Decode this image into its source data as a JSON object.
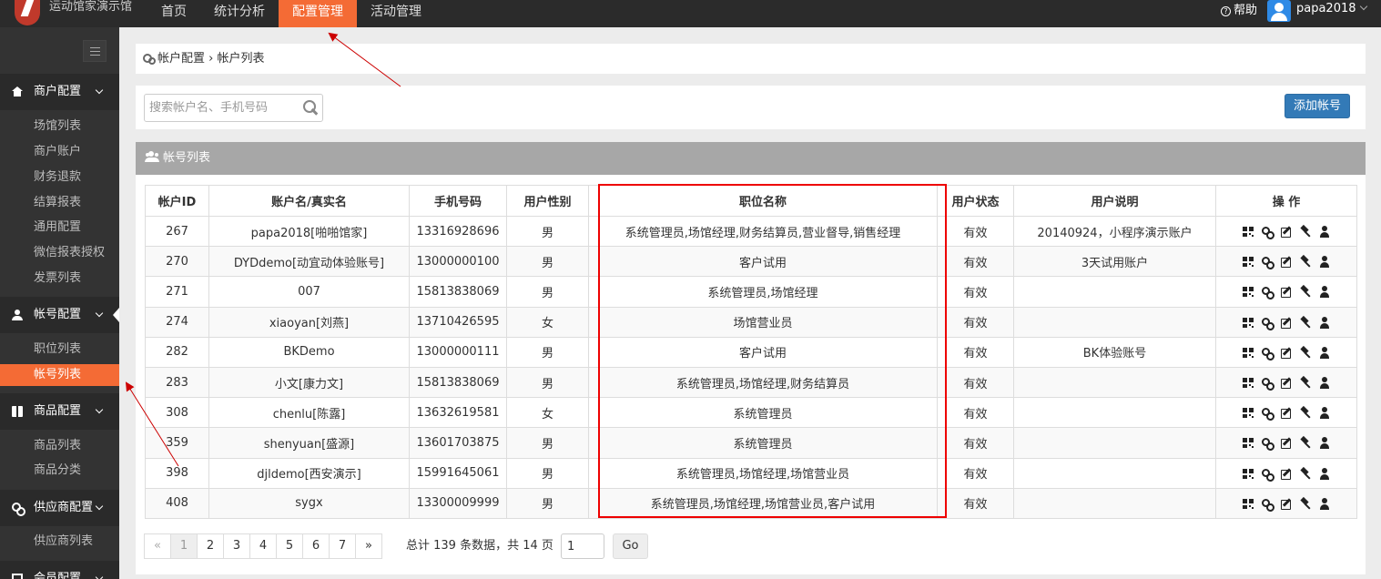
{
  "topbar": {
    "brand": "运动馆家演示馆",
    "nav": [
      {
        "label": "首页"
      },
      {
        "label": "统计分析"
      },
      {
        "label": "配置管理",
        "active": true
      },
      {
        "label": "活动管理"
      }
    ],
    "help": "帮助",
    "username": "papa2018"
  },
  "sidebar": {
    "groups": [
      {
        "label": "商户配置",
        "icon": "home-icon",
        "items": [
          "场馆列表",
          "商户账户",
          "财务退款",
          "结算报表",
          "通用配置",
          "微信报表授权",
          "发票列表"
        ]
      },
      {
        "label": "帐号配置",
        "icon": "user-icon",
        "items": [
          "职位列表",
          "帐号列表"
        ],
        "active_item": "帐号列表"
      },
      {
        "label": "商品配置",
        "icon": "gift-icon",
        "items": [
          "商品列表",
          "商品分类"
        ]
      },
      {
        "label": "供应商配置",
        "icon": "link-icon",
        "items": [
          "供应商列表"
        ]
      },
      {
        "label": "会员配置",
        "icon": "card-icon",
        "items": []
      }
    ]
  },
  "breadcrumb": {
    "parent": "帐户配置",
    "separator": "›",
    "current": "帐户列表"
  },
  "search": {
    "placeholder": "搜索帐户名、手机号码",
    "value": ""
  },
  "add_button": "添加帐号",
  "list": {
    "title": "帐号列表",
    "columns": [
      "帐户ID",
      "账户名/真实名",
      "手机号码",
      "用户性别",
      "职位名称",
      "用户状态",
      "用户说明",
      "操 作"
    ],
    "rows": [
      [
        "267",
        "papa2018[啪啪馆家]",
        "13316928696",
        "男",
        "系统管理员,场馆经理,财务结算员,营业督导,销售经理",
        "有效",
        "20140924，小程序演示账户"
      ],
      [
        "270",
        "DYDdemo[动宜动体验账号]",
        "13000000100",
        "男",
        "客户试用",
        "有效",
        "3天试用账户"
      ],
      [
        "271",
        "007",
        "15813838069",
        "男",
        "系统管理员,场馆经理",
        "有效",
        ""
      ],
      [
        "274",
        "xiaoyan[刘燕]",
        "13710426595",
        "女",
        "场馆营业员",
        "有效",
        ""
      ],
      [
        "282",
        "BKDemo",
        "13000000111",
        "男",
        "客户试用",
        "有效",
        "BK体验账号"
      ],
      [
        "283",
        "小文[康力文]",
        "15813838069",
        "男",
        "系统管理员,场馆经理,财务结算员",
        "有效",
        ""
      ],
      [
        "308",
        "chenlu[陈露]",
        "13632619581",
        "女",
        "系统管理员",
        "有效",
        ""
      ],
      [
        "359",
        "shenyuan[盛源]",
        "13601703875",
        "男",
        "系统管理员",
        "有效",
        ""
      ],
      [
        "398",
        "djldemo[西安演示]",
        "15991645061",
        "男",
        "系统管理员,场馆经理,场馆营业员",
        "有效",
        ""
      ],
      [
        "408",
        "sygx",
        "13300009999",
        "男",
        "系统管理员,场馆经理,场馆营业员,客户试用",
        "有效",
        ""
      ]
    ],
    "row_actions": [
      "qrcode-icon",
      "link-icon",
      "edit-icon",
      "gavel-icon",
      "user-permission-icon"
    ]
  },
  "pagination": {
    "prev": "«",
    "pages": [
      "1",
      "2",
      "3",
      "4",
      "5",
      "6",
      "7"
    ],
    "current": "1",
    "next": "»",
    "info": "总计 139 条数据，共 14 页",
    "page_input": "1",
    "go": "Go"
  },
  "colors": {
    "accent": "#f46b35",
    "primary_button": "#337ab7",
    "highlight_box": "#e00000",
    "annotation_arrow": "#cc0000"
  }
}
